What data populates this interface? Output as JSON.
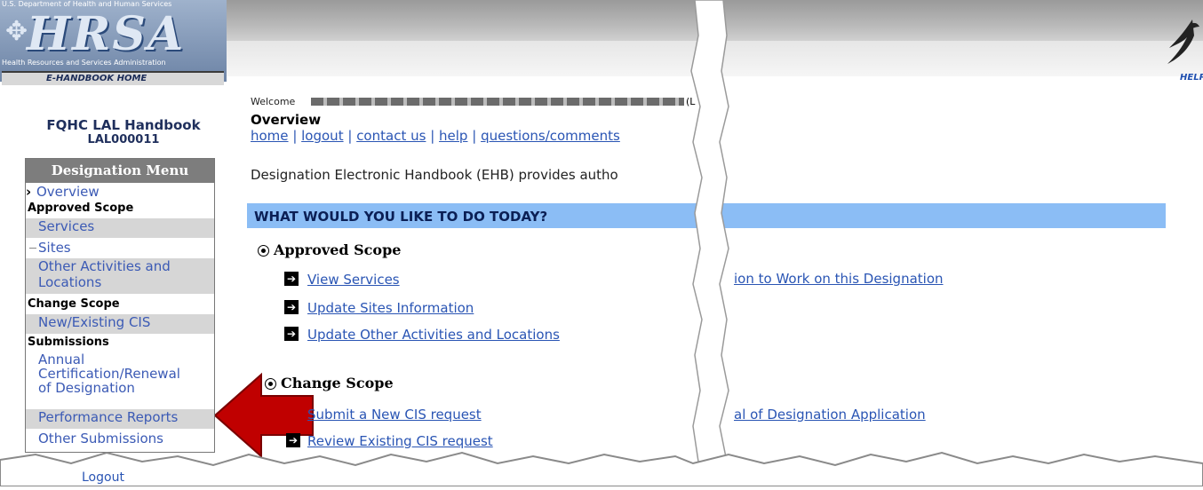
{
  "header": {
    "dept": "U.S. Department of Health and Human Services",
    "logo_word": "HRSA",
    "logo_sub": "Health Resources and Services Administration",
    "home_link": "E-HANDBOOK HOME",
    "help": "HELP"
  },
  "sidebar": {
    "handbook_title": "FQHC LAL Handbook",
    "handbook_id": "LAL000011",
    "menu_title": "Designation Menu",
    "overview": "Overview",
    "approved_scope": "Approved Scope",
    "services": "Services",
    "sites": "Sites",
    "other_line1": "Other Activities and",
    "other_line2": "Locations",
    "change_scope": "Change Scope",
    "cis": "New/Existing CIS",
    "submissions": "Submissions",
    "annual_line1": "Annual",
    "annual_line2": "Certification/Renewal",
    "annual_line3": "of Designation",
    "performance": "Performance Reports",
    "other_submissions": "Other Submissions",
    "logout": "Logout"
  },
  "main": {
    "welcome": "Welcome",
    "welcome_tail": "(L",
    "overview_title": "Overview",
    "nav": [
      "home",
      "logout",
      "contact us",
      "help",
      "questions/comments"
    ],
    "intro": "Designation Electronic Handbook (EHB) provides autho",
    "banner": "WHAT WOULD YOU LIKE TO DO TODAY?",
    "approved_scope": "Approved Scope",
    "approved_actions": [
      "View Services",
      "Update Sites Information",
      "Update Other Activities and Locations"
    ],
    "change_scope": "Change Scope",
    "change_actions": [
      "Submit a New CIS request",
      "Review Existing CIS request"
    ],
    "right_link_1": "ion to Work on this Designation",
    "right_link_2": "al of Designation Application"
  },
  "colors": {
    "banner": "#8bbdf5",
    "link": "#2a55b4",
    "menu_header": "#7d7d7d",
    "arrow": "#c00000"
  }
}
